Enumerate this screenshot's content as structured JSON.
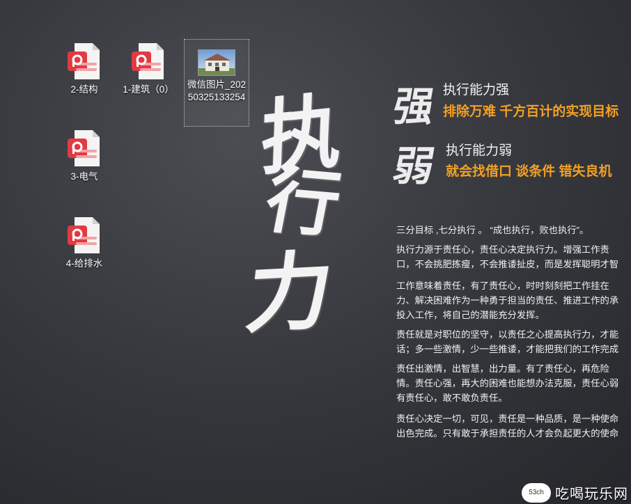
{
  "desktop": {
    "icons": [
      {
        "label": "2-结构",
        "type": "pdf-icon"
      },
      {
        "label": "1-建筑（0）",
        "type": "pdf-icon"
      },
      {
        "label": "微信图片_20250325133254",
        "type": "image-thumbnail"
      },
      {
        "label": "3-电气",
        "type": "pdf-icon"
      },
      {
        "label": "4-给排水",
        "type": "pdf-icon"
      }
    ]
  },
  "wallpaper": {
    "big_chars": [
      "执",
      "行",
      "力"
    ],
    "strong": {
      "char": "强",
      "title": "执行能力强",
      "subtitle": "排除万难 千方百计的实现目标"
    },
    "weak": {
      "char": "弱",
      "title": "执行能力弱",
      "subtitle": "就会找借口 谈条件 错失良机"
    },
    "paragraphs": [
      {
        "lines": [
          "三分目标 ,七分执行 。 “成也执行，败也执行”。"
        ]
      },
      {
        "lines": [
          "执行力源于责任心，责任心决定执行力。增强工作责",
          "口，不会挑肥拣瘦，不会推诿扯皮，而是发挥聪明才智"
        ]
      },
      {
        "lines": [
          "工作意味着责任，有了责任心，时时刻刻把工作挂在",
          "力、解决困难作为一种勇于担当的责任、推进工作的承",
          "投入工作，将自己的潜能充分发挥。"
        ]
      },
      {
        "lines": [
          "责任就是对职位的坚守，以责任之心提高执行力，才能",
          "话；多一些激情，少一些推诿，才能把我们的工作完成"
        ]
      },
      {
        "lines": [
          "责任出激情，出智慧，出力量。有了责任心，再危险",
          "情。责任心强，再大的困难也能想办法克服，责任心弱",
          "有责任心，敢不敢负责任。"
        ]
      },
      {
        "lines": [
          "责任心决定一切，可见，责任是一种品质，是一种使命",
          "出色完成。只有敢于承担责任的人才会负起更大的使命"
        ]
      }
    ]
  },
  "watermark": {
    "badge": "53ch",
    "text": "吃喝玩乐网"
  },
  "colors": {
    "accent": "#f2a024",
    "pdf_red": "#e23a42",
    "text": "#ffffff"
  }
}
